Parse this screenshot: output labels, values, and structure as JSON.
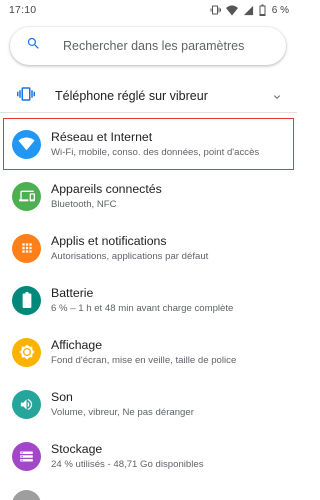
{
  "status_bar": {
    "time": "17:10",
    "battery": "6 %"
  },
  "search": {
    "placeholder": "Rechercher dans les paramètres"
  },
  "suggestion": {
    "text": "Téléphone réglé sur vibreur"
  },
  "settings": [
    {
      "title": "Réseau et Internet",
      "subtitle": "Wi-Fi, mobile, conso. des données, point d'accès",
      "icon": "wifi-icon",
      "color": "#2196f3"
    },
    {
      "title": "Appareils connectés",
      "subtitle": "Bluetooth, NFC",
      "icon": "devices-icon",
      "color": "#4caf50"
    },
    {
      "title": "Applis et notifications",
      "subtitle": "Autorisations, applications par défaut",
      "icon": "apps-icon",
      "color": "#ff7f1a"
    },
    {
      "title": "Batterie",
      "subtitle": "6 % – 1 h et 48 min avant charge complète",
      "icon": "battery-icon",
      "color": "#00897b"
    },
    {
      "title": "Affichage",
      "subtitle": "Fond d'écran, mise en veille, taille de police",
      "icon": "brightness-icon",
      "color": "#fbb300"
    },
    {
      "title": "Son",
      "subtitle": "Volume, vibreur, Ne pas déranger",
      "icon": "volume-icon",
      "color": "#26a69a"
    },
    {
      "title": "Stockage",
      "subtitle": "24 % utilisés - 48,71 Go disponibles",
      "icon": "storage-icon",
      "color": "#a347c9"
    }
  ],
  "colors": {
    "highlight": "#e53935",
    "search_icon": "#1a73e8",
    "suggestion_icon": "#1a73e8"
  }
}
